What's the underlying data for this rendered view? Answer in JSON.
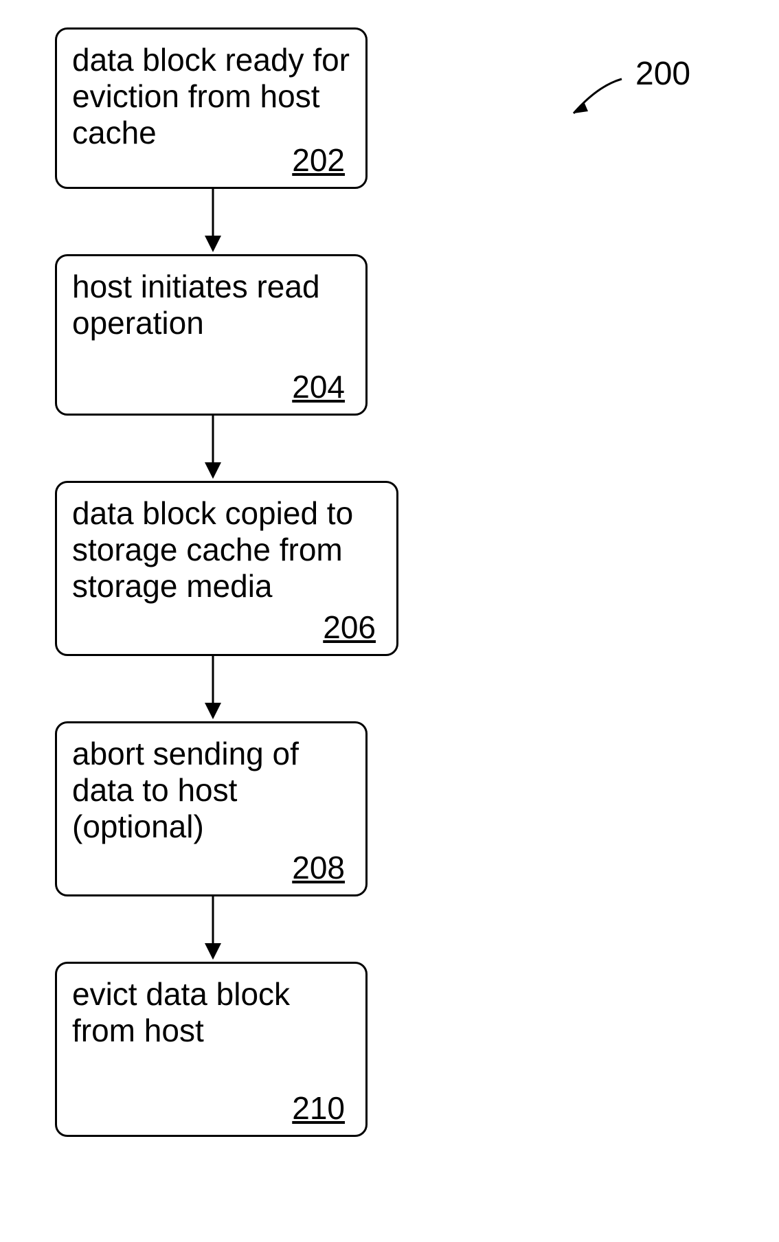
{
  "figure": {
    "ref_number": "200",
    "ref_arrow_glyph": "↙"
  },
  "steps": [
    {
      "text": "data block ready for eviction from host cache",
      "num": "202"
    },
    {
      "text": "host initiates read operation",
      "num": "204"
    },
    {
      "text": "data block copied to storage cache from storage media",
      "num": "206"
    },
    {
      "text": "abort sending of data to host (optional)",
      "num": "208"
    },
    {
      "text": "evict data block from host",
      "num": "210"
    }
  ],
  "chart_data": {
    "type": "flowchart",
    "title": "",
    "reference_number": "200",
    "nodes": [
      {
        "id": "202",
        "label": "data block ready for eviction from host cache"
      },
      {
        "id": "204",
        "label": "host initiates read operation"
      },
      {
        "id": "206",
        "label": "data block copied to storage cache from storage media"
      },
      {
        "id": "208",
        "label": "abort sending of data to host (optional)"
      },
      {
        "id": "210",
        "label": "evict data block from host"
      }
    ],
    "edges": [
      {
        "from": "202",
        "to": "204"
      },
      {
        "from": "204",
        "to": "206"
      },
      {
        "from": "206",
        "to": "208"
      },
      {
        "from": "208",
        "to": "210"
      }
    ]
  }
}
